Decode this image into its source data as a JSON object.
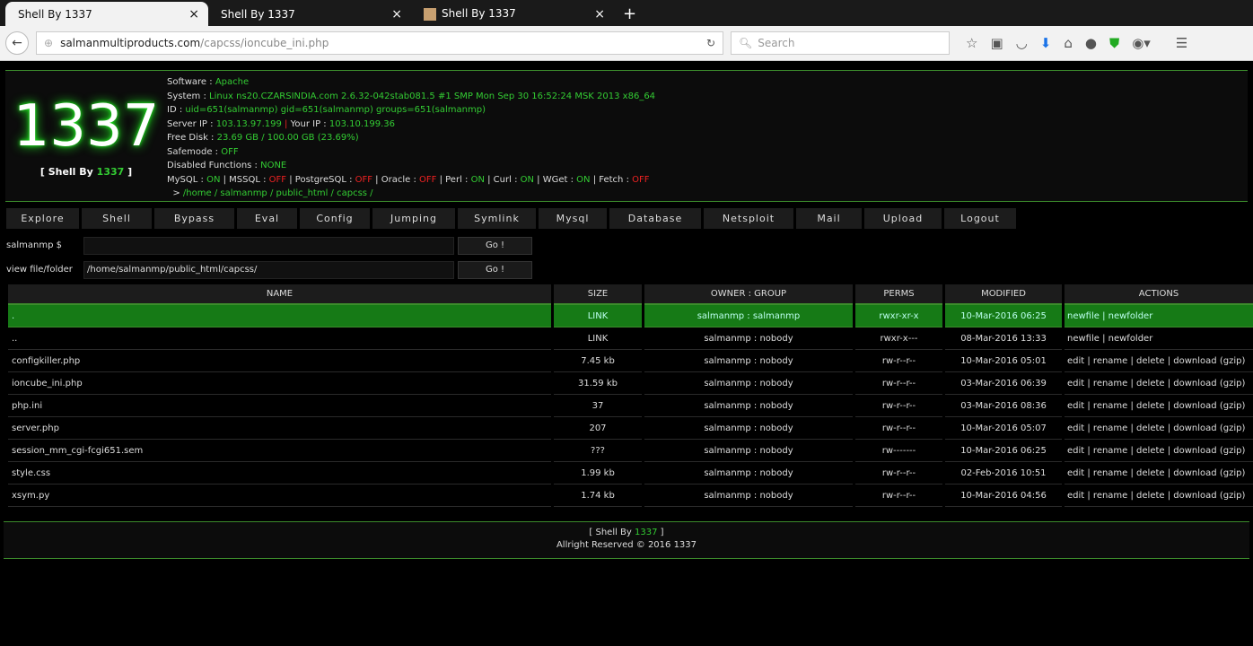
{
  "browser": {
    "tabs": [
      {
        "title": "Shell By 1337"
      },
      {
        "title": "Shell By 1337"
      },
      {
        "title": "Shell By 1337"
      }
    ],
    "url_domain": "salmanmultiproducts.com",
    "url_path": "/capcss/ioncube_ini.php",
    "search_placeholder": "Search"
  },
  "header": {
    "logo": "1337",
    "sub_prefix": "[ Shell By ",
    "sub_brand": "1337",
    "sub_suffix": " ]",
    "software": "Apache",
    "system": "Linux ns20.CZARSINDIA.com 2.6.32-042stab081.5 #1 SMP Mon Sep 30 16:52:24 MSK 2013 x86_64",
    "id": "uid=651(salmanmp) gid=651(salmanmp) groups=651(salmanmp)",
    "server_ip": "103.13.97.199",
    "your_ip": "103.10.199.36",
    "free_disk": "23.69 GB / 100.00 GB (23.69%)",
    "safemode": "OFF",
    "disabled_functions": "NONE",
    "features": [
      {
        "name": "MySQL",
        "state": "ON"
      },
      {
        "name": "MSSQL",
        "state": "OFF"
      },
      {
        "name": "PostgreSQL",
        "state": "OFF"
      },
      {
        "name": "Oracle",
        "state": "OFF"
      },
      {
        "name": "Perl",
        "state": "ON"
      },
      {
        "name": "Curl",
        "state": "ON"
      },
      {
        "name": "WGet",
        "state": "ON"
      },
      {
        "name": "Fetch",
        "state": "OFF"
      }
    ],
    "path": "/home / salmanmp / public_html / capcss /"
  },
  "menu": [
    "Explore",
    "Shell",
    "Bypass",
    "Eval",
    "Config",
    "Jumping",
    "Symlink",
    "Mysql",
    "Database",
    "Netsploit",
    "Mail",
    "Upload",
    "Logout"
  ],
  "form": {
    "cmd_label": "salmanmp $",
    "cmd_value": "",
    "view_label": "view file/folder",
    "view_value": "/home/salmanmp/public_html/capcss/",
    "go": "Go !"
  },
  "table": {
    "headers": [
      "NAME",
      "SIZE",
      "OWNER : GROUP",
      "PERMS",
      "MODIFIED",
      "ACTIONS"
    ],
    "rows": [
      [
        ".",
        "LINK",
        "salmanmp : salmanmp",
        "rwxr-xr-x",
        "10-Mar-2016 06:25",
        "newfile | newfolder"
      ],
      [
        "..",
        "LINK",
        "salmanmp : nobody",
        "rwxr-x---",
        "08-Mar-2016 13:33",
        "newfile | newfolder"
      ],
      [
        "configkiller.php",
        "7.45 kb",
        "salmanmp : nobody",
        "rw-r--r--",
        "10-Mar-2016 05:01",
        "edit | rename | delete | download (gzip)"
      ],
      [
        "ioncube_ini.php",
        "31.59 kb",
        "salmanmp : nobody",
        "rw-r--r--",
        "03-Mar-2016 06:39",
        "edit | rename | delete | download (gzip)"
      ],
      [
        "php.ini",
        "37",
        "salmanmp : nobody",
        "rw-r--r--",
        "03-Mar-2016 08:36",
        "edit | rename | delete | download (gzip)"
      ],
      [
        "server.php",
        "207",
        "salmanmp : nobody",
        "rw-r--r--",
        "10-Mar-2016 05:07",
        "edit | rename | delete | download (gzip)"
      ],
      [
        "session_mm_cgi-fcgi651.sem",
        "???",
        "salmanmp : nobody",
        "rw-------",
        "10-Mar-2016 06:25",
        "edit | rename | delete | download (gzip)"
      ],
      [
        "style.css",
        "1.99 kb",
        "salmanmp : nobody",
        "rw-r--r--",
        "02-Feb-2016 10:51",
        "edit | rename | delete | download (gzip)"
      ],
      [
        "xsym.py",
        "1.74 kb",
        "salmanmp : nobody",
        "rw-r--r--",
        "10-Mar-2016 04:56",
        "edit | rename | delete | download (gzip)"
      ]
    ]
  },
  "footer": {
    "prefix": "[ Shell By ",
    "brand": "1337",
    "suffix": " ]",
    "rights": "Allright Reserved © 2016 1337"
  }
}
